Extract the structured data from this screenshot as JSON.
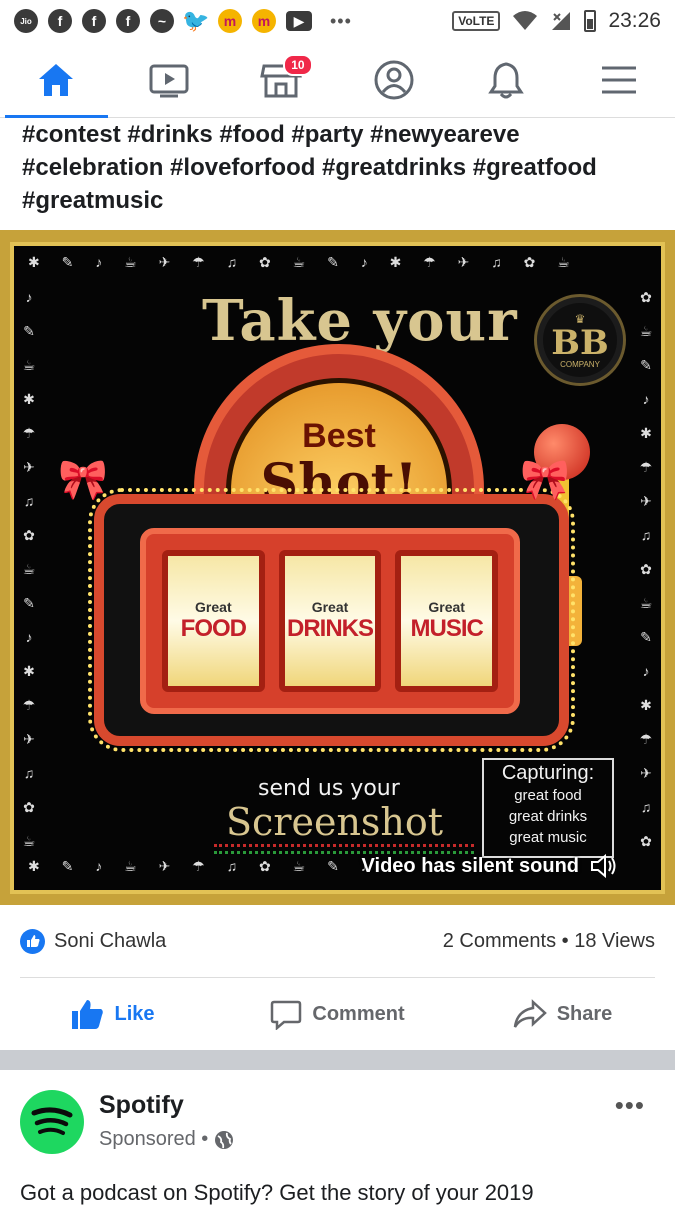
{
  "status_bar": {
    "carrier_icon": "Jio",
    "app_icons": [
      "facebook-icon",
      "facebook-icon",
      "facebook-icon",
      "messenger-icon",
      "twitter-icon",
      "m-icon",
      "m-icon",
      "youtube-icon"
    ],
    "overflow": "•••",
    "network": "VoLTE",
    "time": "23:26"
  },
  "nav": {
    "tabs": [
      "home",
      "watch",
      "marketplace",
      "profile",
      "notifications",
      "menu"
    ],
    "marketplace_badge": "10",
    "active_color": "#1877f2"
  },
  "post": {
    "text": "#contest #drinks #food #party #newyeareve #celebration #loveforfood #greatdrinks #greatfood #greatmusic",
    "video": {
      "headline": "Take your",
      "dome_line1": "Best",
      "dome_line2": "Shot!",
      "logo_initials": "BB",
      "logo_text": "COMPANY",
      "reels": [
        {
          "top": "Great",
          "word": "FOOD"
        },
        {
          "top": "Great",
          "word": "DRINKS"
        },
        {
          "top": "Great",
          "word": "MUSIC"
        }
      ],
      "send_text": "send us your",
      "screenshot_text": "Screenshot",
      "capturing_title": "Capturing:",
      "capturing_lines": [
        "great food",
        "great drinks",
        "great music"
      ],
      "silent_label": "Video has silent sound"
    },
    "author": "Soni Chawla",
    "stats": "2 Comments • 18 Views",
    "actions": {
      "like": "Like",
      "comment": "Comment",
      "share": "Share"
    }
  },
  "sponsored": {
    "name": "Spotify",
    "label": "Sponsored •",
    "more": "•••",
    "text": "Got a podcast on Spotify? Get the story of your 2019",
    "brand_color": "#1ed760"
  }
}
